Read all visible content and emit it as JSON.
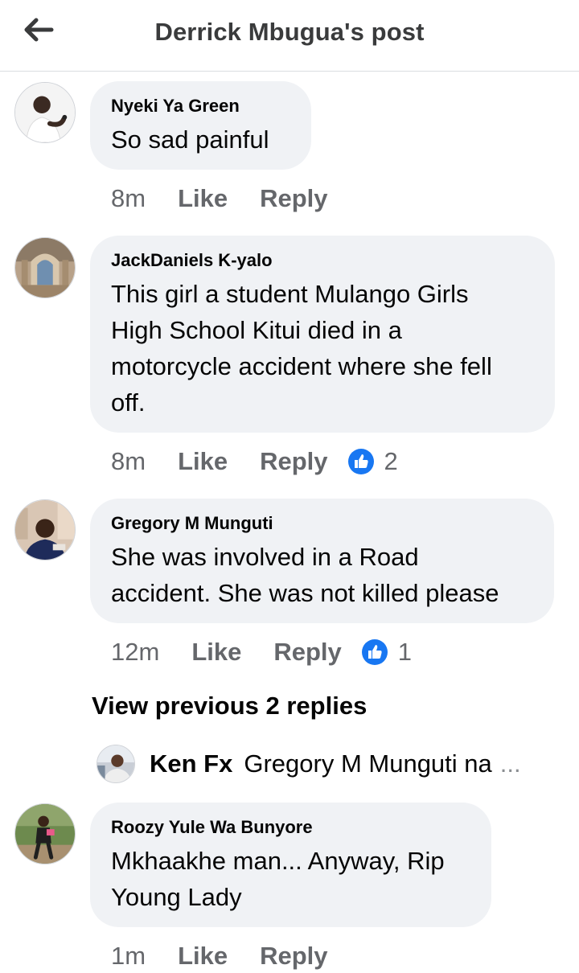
{
  "header": {
    "title": "Derrick Mbugua's post",
    "back_icon": "arrow-left-icon"
  },
  "comments": [
    {
      "author": "Nyeki Ya Green",
      "text": "So sad painful",
      "time": "8m",
      "like_label": "Like",
      "reply_label": "Reply"
    },
    {
      "author": "JackDaniels K-yalo",
      "text_lines": [
        "This girl a student Mulango Girls",
        "High School Kitui died in a",
        "motorcycle accident where she fell",
        "off."
      ],
      "time": "8m",
      "like_label": "Like",
      "reply_label": "Reply",
      "reaction_count": "2"
    },
    {
      "author": "Gregory M Munguti",
      "text_lines": [
        "She was involved in a Road",
        "accident. She was not killed please"
      ],
      "time": "12m",
      "like_label": "Like",
      "reply_label": "Reply",
      "reaction_count": "1"
    },
    {
      "author": "Roozy Yule Wa Bunyore",
      "text_lines": [
        "Mkhaakhe man... Anyway, Rip",
        "Young Lady"
      ],
      "time": "1m",
      "like_label": "Like",
      "reply_label": "Reply"
    }
  ],
  "replies": {
    "view_previous_label": "View previous 2 replies",
    "latest": {
      "author": "Ken Fx",
      "text": "Gregory M Munguti na",
      "ellipsis": "..."
    }
  },
  "colors": {
    "bubble": "#f0f2f5",
    "secondary_text": "#65676b",
    "like_blue": "#1877f2"
  }
}
